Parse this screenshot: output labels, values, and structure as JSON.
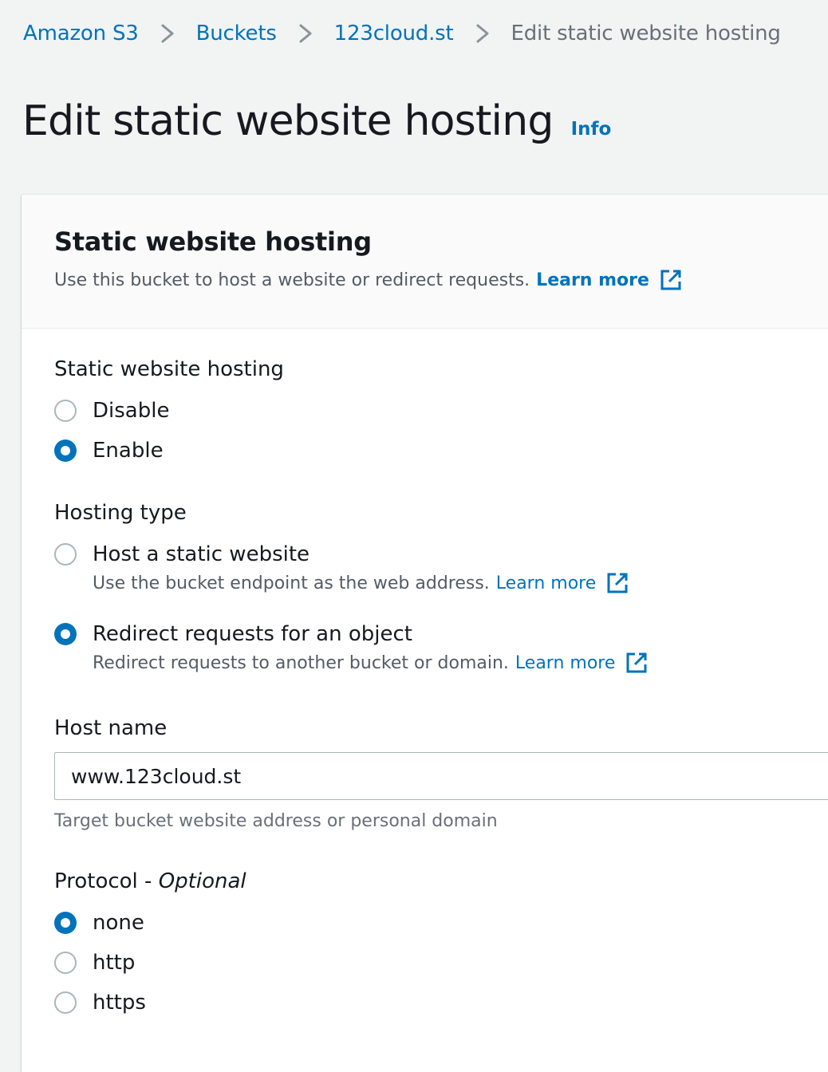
{
  "breadcrumb": {
    "items": [
      "Amazon S3",
      "Buckets",
      "123cloud.st"
    ],
    "current": "Edit static website hosting"
  },
  "page": {
    "title": "Edit static website hosting",
    "info_link": "Info"
  },
  "panel": {
    "header": {
      "title": "Static website hosting",
      "description": "Use this bucket to host a website or redirect requests.",
      "learn_more": "Learn more"
    },
    "hosting": {
      "label": "Static website hosting",
      "options": [
        "Disable",
        "Enable"
      ],
      "selected": "Enable"
    },
    "hosting_type": {
      "label": "Hosting type",
      "options": [
        {
          "label": "Host a static website",
          "description": "Use the bucket endpoint as the web address.",
          "learn_more": "Learn more"
        },
        {
          "label": "Redirect requests for an object",
          "description": "Redirect requests to another bucket or domain.",
          "learn_more": "Learn more"
        }
      ],
      "selected": "Redirect requests for an object"
    },
    "host_name": {
      "label": "Host name",
      "value": "www.123cloud.st",
      "hint": "Target bucket website address or personal domain"
    },
    "protocol": {
      "label": "Protocol - ",
      "label_optional": "Optional",
      "options": [
        "none",
        "http",
        "https"
      ],
      "selected": "none"
    }
  },
  "colors": {
    "link": "#0073bb",
    "radio_checked": "#0073bb",
    "page_bg": "#f2f3f3",
    "text": "#16191f",
    "muted": "#545b64"
  },
  "icons": {
    "breadcrumb_separator": "chevron-right-icon",
    "external_link": "external-link-icon"
  }
}
